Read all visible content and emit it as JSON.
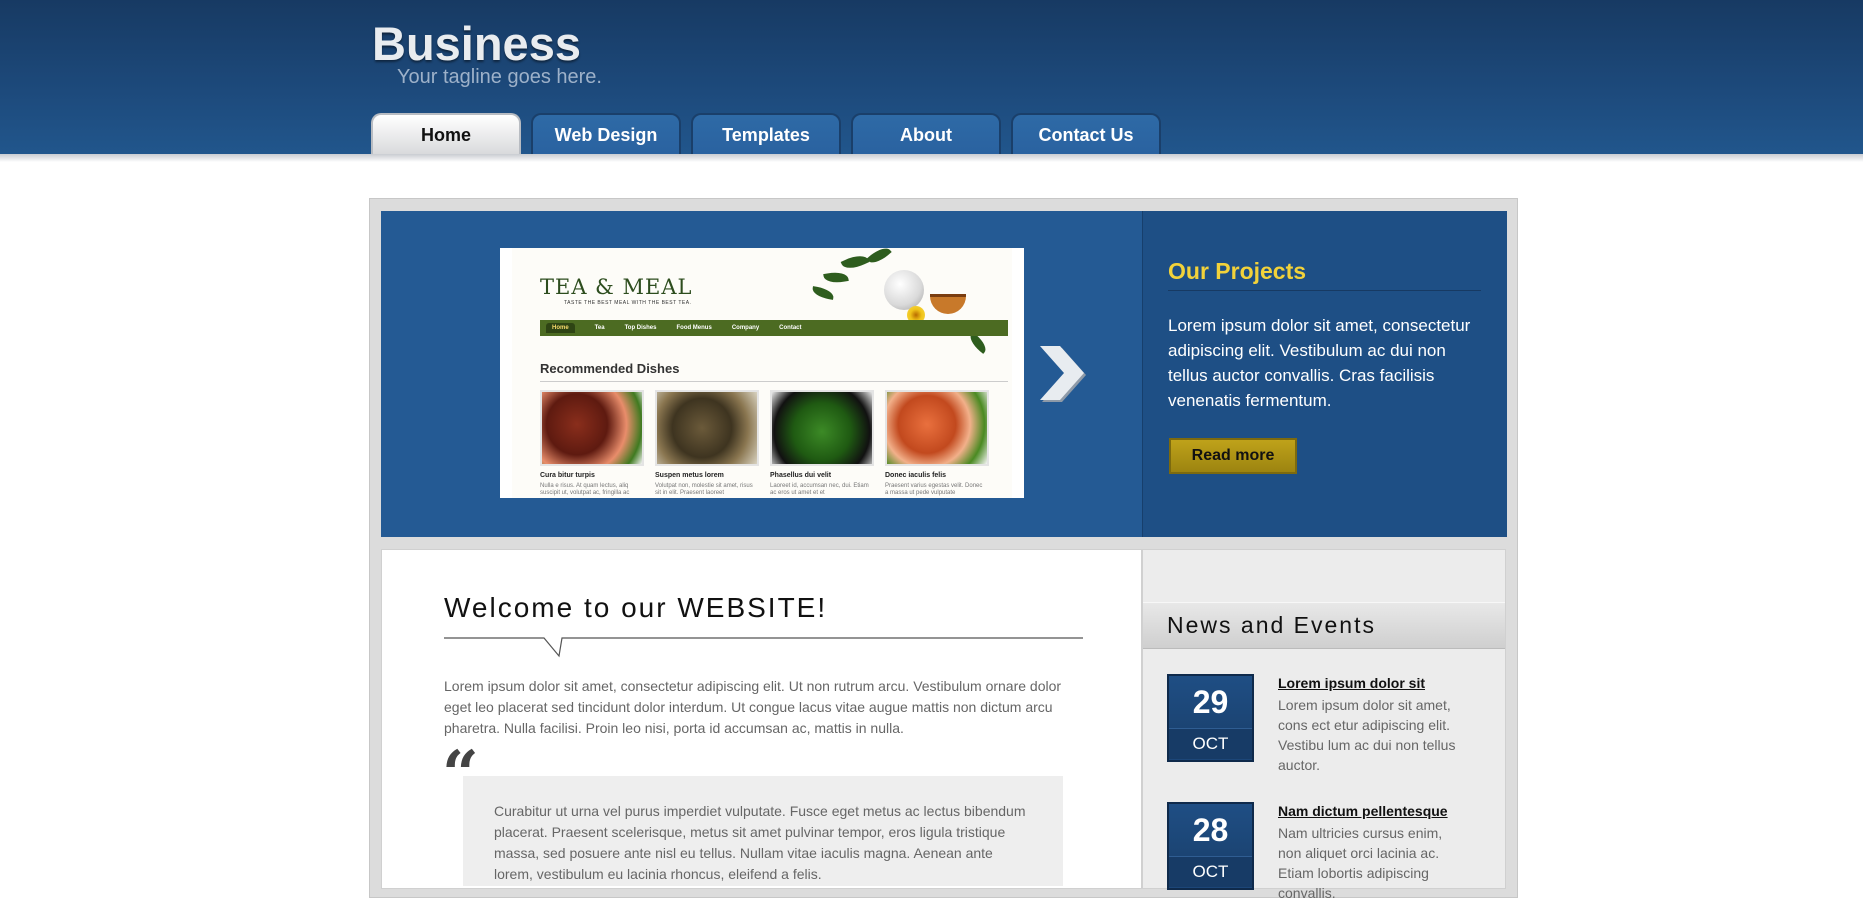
{
  "header": {
    "brand": "Business",
    "tagline": "Your tagline goes here.",
    "nav": [
      {
        "label": "Home",
        "active": true
      },
      {
        "label": "Web Design",
        "active": false
      },
      {
        "label": "Templates",
        "active": false
      },
      {
        "label": "About",
        "active": false
      },
      {
        "label": "Contact Us",
        "active": false
      }
    ]
  },
  "banner": {
    "preview": {
      "title": "TEA & MEAL",
      "subtitle": "TASTE THE BEST MEAL WITH THE BEST TEA.",
      "nav": [
        "Home",
        "Tea",
        "Top Dishes",
        "Food Menus",
        "Company",
        "Contact"
      ],
      "section_title": "Recommended Dishes",
      "dishes": [
        {
          "caption": "Cura bitur turpis",
          "text": "Nulla e risus. At quam lectus, aliq suscipit ut, volutpat ac, fringilla ac"
        },
        {
          "caption": "Suspen metus lorem",
          "text": "Volutpat non, molestie sit amet, risus sit in elit. Praesent laoreet"
        },
        {
          "caption": "Phasellus dui velit",
          "text": "Laoreet id, accumsan nec, dui. Etiam ac eros ut amet et et"
        },
        {
          "caption": "Donec iaculis felis",
          "text": "Praesent varius egestas velit. Donec a massa ut pede vulputate"
        }
      ]
    },
    "projects_title": "Our Projects",
    "projects_text": "Lorem ipsum dolor sit amet, consectetur adipiscing elit. Vestibulum ac dui non tellus auctor convallis. Cras facilisis venenatis fermentum.",
    "read_more": "Read more"
  },
  "welcome": {
    "title": "Welcome to our WEBSITE!",
    "paragraph": "Lorem ipsum dolor sit amet, consectetur adipiscing elit. Ut non rutrum arcu. Vestibulum ornare dolor eget leo placerat sed tincidunt dolor interdum. Ut congue lacus vitae augue mattis non dictum arcu pharetra. Nulla facilisi. Proin leo nisi, porta id accumsan ac, mattis in nulla.",
    "quote_mark": "“",
    "quote": "Curabitur ut urna vel purus imperdiet vulputate. Fusce eget metus ac lectus bibendum placerat. Praesent scelerisque, metus sit amet pulvinar tempor, eros ligula tristique massa, sed posuere ante nisl eu tellus. Nullam vitae iaculis magna. Aenean ante lorem, vestibulum eu lacinia rhoncus, eleifend a felis."
  },
  "news": {
    "title": "News and Events",
    "items": [
      {
        "day": "29",
        "month": "OCT",
        "headline": "Lorem ipsum dolor sit",
        "text": "Lorem ipsum dolor sit amet, cons ect etur adipiscing elit. Vestibu lum ac dui non tellus auctor."
      },
      {
        "day": "28",
        "month": "OCT",
        "headline": "Nam dictum pellentesque",
        "text": "Nam ultricies cursus enim, non aliquet orci lacinia ac. Etiam lobortis adipiscing convallis."
      }
    ]
  },
  "colors": {
    "header_bg": "#1d4a7c",
    "banner_bg": "#245a94",
    "accent_yellow": "#f2d23a",
    "button_gold": "#bfa21a"
  }
}
